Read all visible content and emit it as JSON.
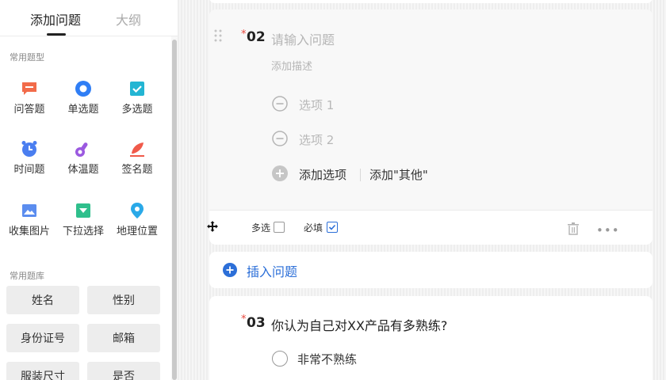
{
  "sidebar": {
    "tabs": [
      {
        "label": "添加问题",
        "active": true
      },
      {
        "label": "大纲",
        "active": false
      }
    ],
    "common_types_title": "常用题型",
    "question_types": [
      {
        "label": "问答题",
        "icon": "message-icon",
        "color": "#f26b4a"
      },
      {
        "label": "单选题",
        "icon": "radio-icon",
        "color": "#2f7ef5"
      },
      {
        "label": "多选题",
        "icon": "checkbox-icon",
        "color": "#23b5d3"
      },
      {
        "label": "时间题",
        "icon": "alarm-clock-icon",
        "color": "#4a7ef0"
      },
      {
        "label": "体温题",
        "icon": "thermometer-icon",
        "color": "#9b59e0"
      },
      {
        "label": "签名题",
        "icon": "pen-icon",
        "color": "#f05a4a"
      },
      {
        "label": "收集图片",
        "icon": "image-icon",
        "color": "#5b8def"
      },
      {
        "label": "下拉选择",
        "icon": "dropdown-icon",
        "color": "#2fbf8c"
      },
      {
        "label": "地理位置",
        "icon": "location-pin-icon",
        "color": "#2aa9e8"
      }
    ],
    "library_title": "常用题库",
    "library_items": [
      "姓名",
      "性别",
      "身份证号",
      "邮箱",
      "服装尺寸",
      "是否"
    ]
  },
  "question2": {
    "required_mark": "*",
    "number": "02",
    "title_placeholder": "请输入问题",
    "description_placeholder": "添加描述",
    "options": [
      "选项 1",
      "选项 2"
    ],
    "add_option_label": "添加选项",
    "add_other_label": "添加\"其他\"",
    "multi_select_label": "多选",
    "multi_select_checked": false,
    "required_label": "必填",
    "required_checked": true
  },
  "insert": {
    "label": "插入问题"
  },
  "question3": {
    "required_mark": "*",
    "number": "03",
    "title": "你认为自己对XX产品有多熟练?",
    "options": [
      "非常不熟练"
    ]
  },
  "colors": {
    "accent": "#2c6fd8",
    "required": "#e8473d"
  }
}
